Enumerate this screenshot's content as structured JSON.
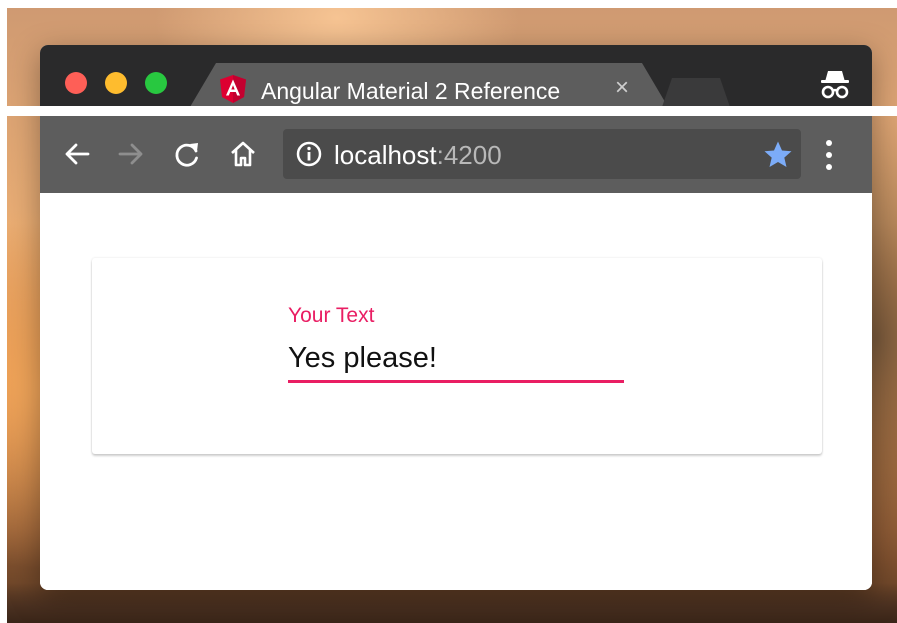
{
  "window": {
    "tab": {
      "title": "Angular Material 2 Reference",
      "close_glyph": "×",
      "favicon": "angular-logo-icon"
    },
    "icons": {
      "back": "back-arrow-icon",
      "forward": "forward-arrow-icon",
      "reload": "reload-icon",
      "home": "home-icon",
      "info": "info-icon",
      "bookmark": "star-icon",
      "menu": "more-vertical-icon",
      "incognito": "incognito-icon"
    },
    "address_bar": {
      "host": "localhost",
      "port": ":4200"
    }
  },
  "form": {
    "label": "Your Text",
    "value": "Yes please!"
  },
  "colors": {
    "accent": "#e91e63",
    "star": "#7cacf8",
    "angular_red": "#dd0031"
  }
}
